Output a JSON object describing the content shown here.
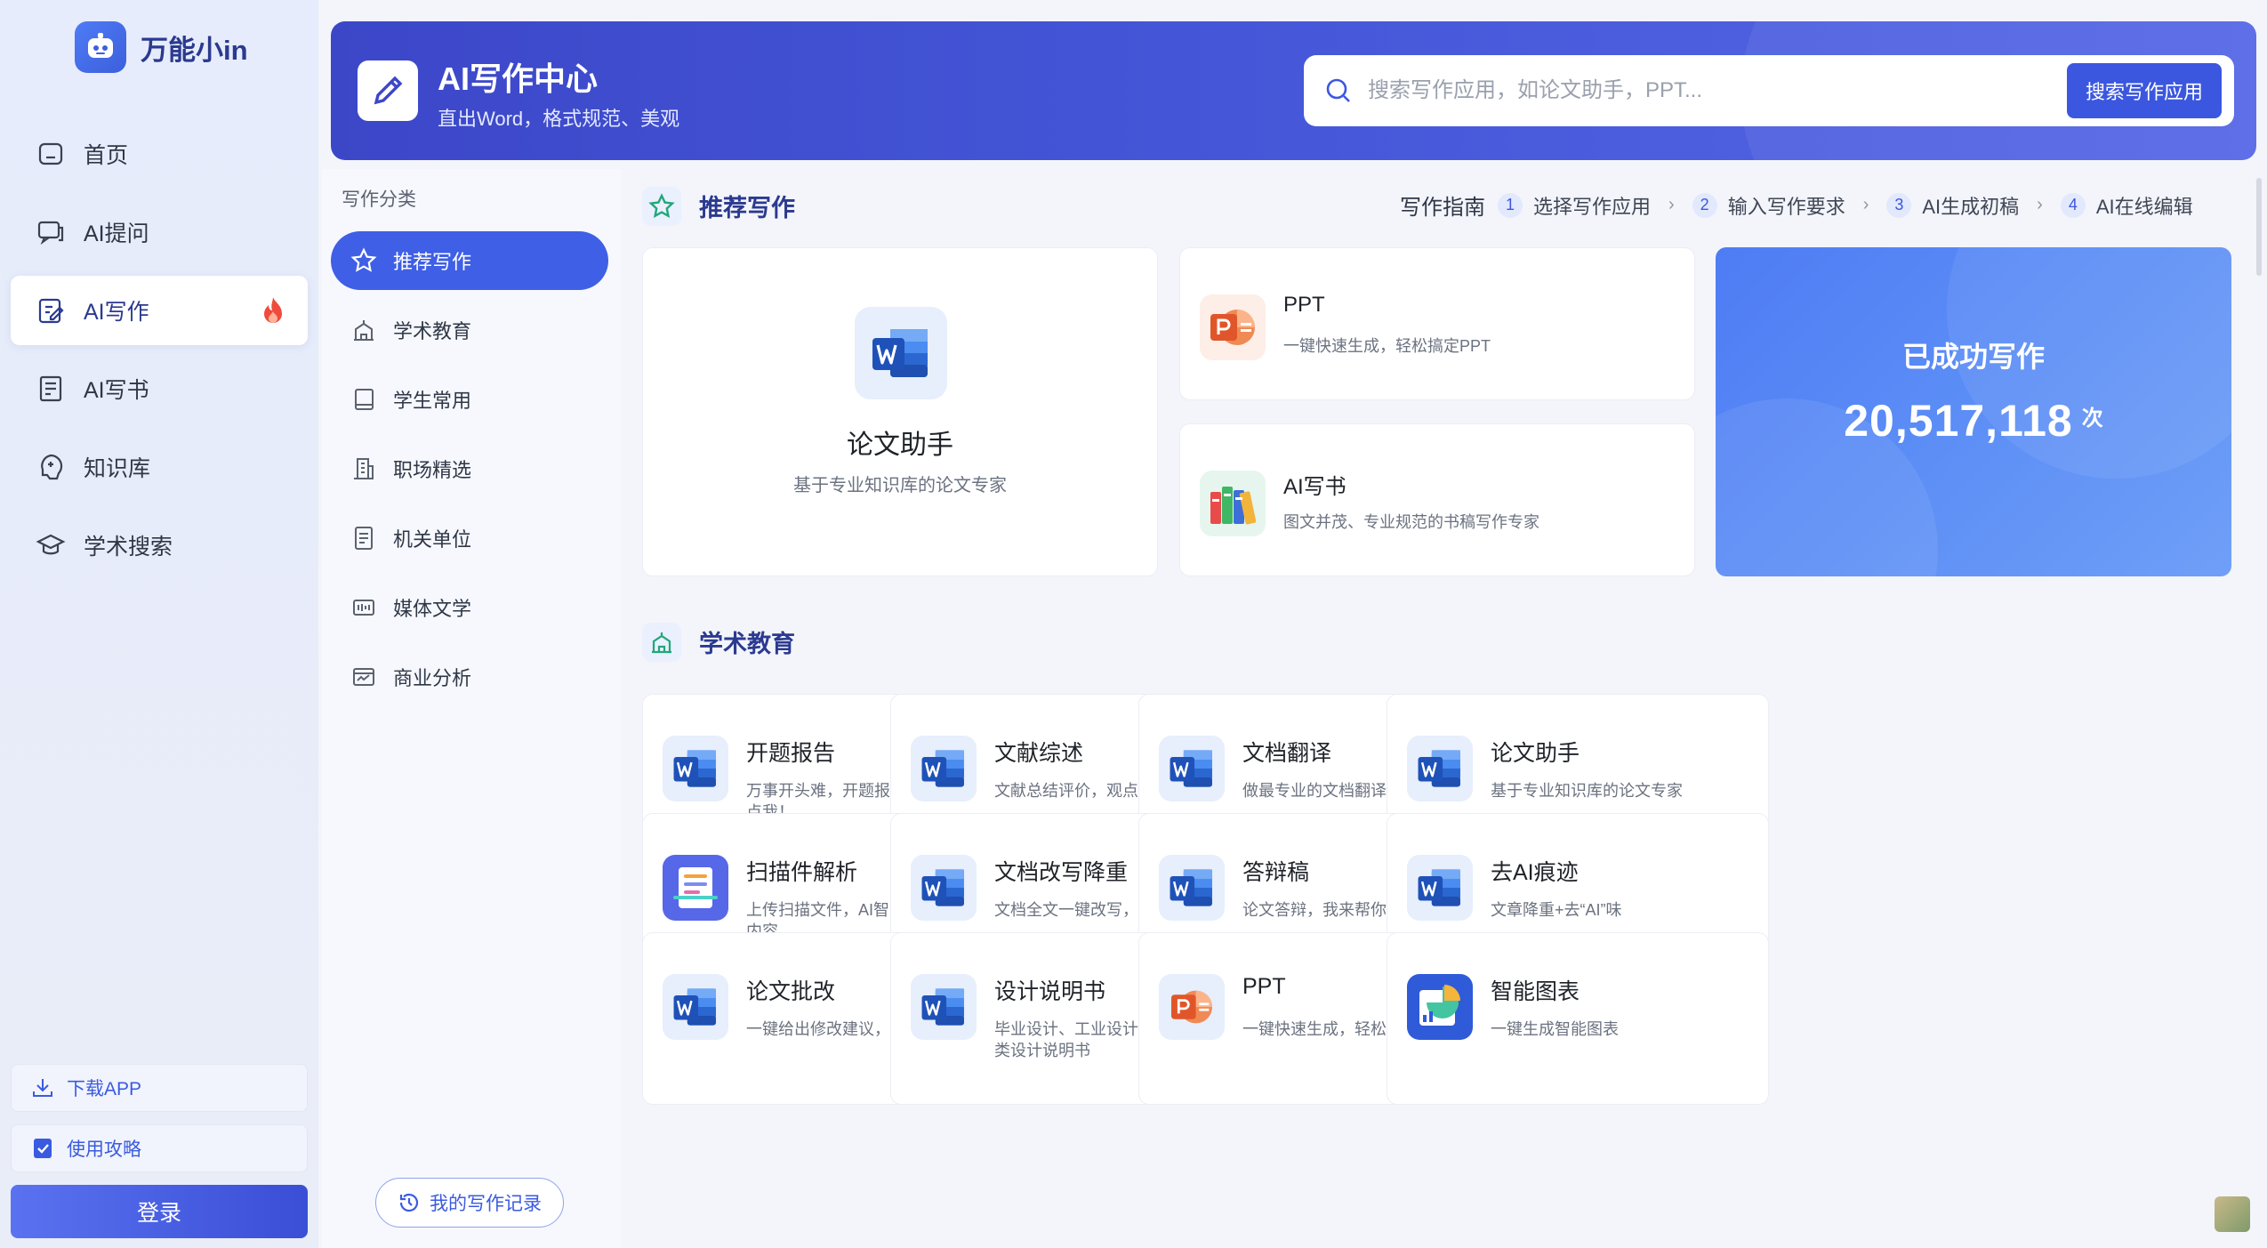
{
  "app": {
    "name": "万能小in"
  },
  "nav": {
    "items": [
      {
        "label": "首页"
      },
      {
        "label": "AI提问"
      },
      {
        "label": "AI写作"
      },
      {
        "label": "AI写书"
      },
      {
        "label": "知识库"
      },
      {
        "label": "学术搜索"
      }
    ],
    "download_label": "下载APP",
    "guide_label": "使用攻略",
    "login_label": "登录"
  },
  "header": {
    "title": "AI写作中心",
    "subtitle": "直出Word，格式规范、美观",
    "search_placeholder": "搜索写作应用，如论文助手，PPT...",
    "search_button": "搜索写作应用"
  },
  "categories": {
    "title": "写作分类",
    "items": [
      {
        "label": "推荐写作"
      },
      {
        "label": "学术教育"
      },
      {
        "label": "学生常用"
      },
      {
        "label": "职场精选"
      },
      {
        "label": "机关单位"
      },
      {
        "label": "媒体文学"
      },
      {
        "label": "商业分析"
      }
    ],
    "history_button": "我的写作记录"
  },
  "recommend": {
    "title": "推荐写作",
    "guide_label": "写作指南",
    "steps": [
      {
        "num": "1",
        "label": "选择写作应用"
      },
      {
        "num": "2",
        "label": "输入写作要求"
      },
      {
        "num": "3",
        "label": "AI生成初稿"
      },
      {
        "num": "4",
        "label": "AI在线编辑"
      }
    ],
    "featured": {
      "title": "论文助手",
      "desc": "基于专业知识库的论文专家"
    },
    "ppt": {
      "title": "PPT",
      "desc": "一键快速生成，轻松搞定PPT"
    },
    "book": {
      "title": "AI写书",
      "desc": "图文并茂、专业规范的书稿写作专家"
    },
    "stat": {
      "label": "已成功写作",
      "value": "20,517,118",
      "unit": "次"
    }
  },
  "academic": {
    "title": "学术教育",
    "tiles": [
      {
        "title": "开题报告",
        "desc": "万事开头难，开题报告特别难～来，点我！",
        "icon": "word-icon"
      },
      {
        "title": "文献综述",
        "desc": "文献总结评价，观点深入剖析",
        "icon": "word-icon"
      },
      {
        "title": "文档翻译",
        "desc": "做最专业的文档翻译助手～",
        "icon": "word-icon"
      },
      {
        "title": "论文助手",
        "desc": "基于专业知识库的论文专家",
        "icon": "word-icon"
      },
      {
        "title": "扫描件解析",
        "desc": "上传扫描文件，AI智能解析提取文字内容。",
        "icon": "scan-icon"
      },
      {
        "title": "文档改写降重",
        "desc": "文档全文一键改写，降重神器",
        "icon": "word-icon"
      },
      {
        "title": "答辩稿",
        "desc": "论文答辩，我来帮你精心准备",
        "icon": "word-icon"
      },
      {
        "title": "去AI痕迹",
        "desc": "文章降重+去“AI”味",
        "icon": "word-icon"
      },
      {
        "title": "论文批改",
        "desc": "一键给出修改建议，高效便捷",
        "icon": "word-icon"
      },
      {
        "title": "设计说明书",
        "desc": "毕业设计、工业设计、平面设计等各类设计说明书",
        "icon": "word-icon"
      },
      {
        "title": "PPT",
        "desc": "一键快速生成，轻松搞定PPT",
        "icon": "ppt-icon"
      },
      {
        "title": "智能图表",
        "desc": "一键生成智能图表",
        "icon": "chart-icon"
      }
    ]
  }
}
